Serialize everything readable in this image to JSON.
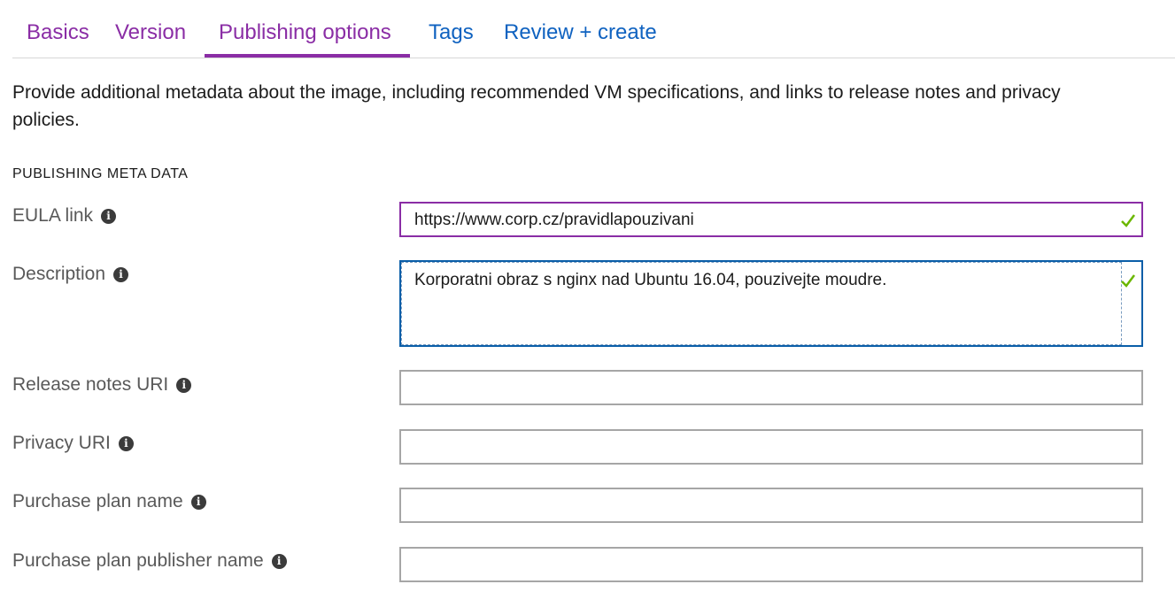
{
  "tabs": [
    {
      "label": "Basics"
    },
    {
      "label": "Version"
    },
    {
      "label": "Publishing options"
    },
    {
      "label": "Tags"
    },
    {
      "label": "Review + create"
    }
  ],
  "intro": "Provide additional metadata about the image, including recommended VM specifications, and links to release notes and privacy policies.",
  "section_title": "PUBLISHING META DATA",
  "fields": [
    {
      "label": "EULA link",
      "value": "https://www.corp.cz/pravidlapouzivani"
    },
    {
      "label": "Description",
      "value": "Korporatni obraz s nginx nad Ubuntu 16.04, pouzivejte moudre."
    },
    {
      "label": "Release notes URI",
      "value": ""
    },
    {
      "label": "Privacy URI",
      "value": ""
    },
    {
      "label": "Purchase plan name",
      "value": ""
    },
    {
      "label": "Purchase plan publisher name",
      "value": ""
    }
  ],
  "colors": {
    "active_tab": "#8a2da5",
    "link_tab": "#0f62c0",
    "valid_check": "#6bb700",
    "focus_border": "#0a5ea8"
  }
}
